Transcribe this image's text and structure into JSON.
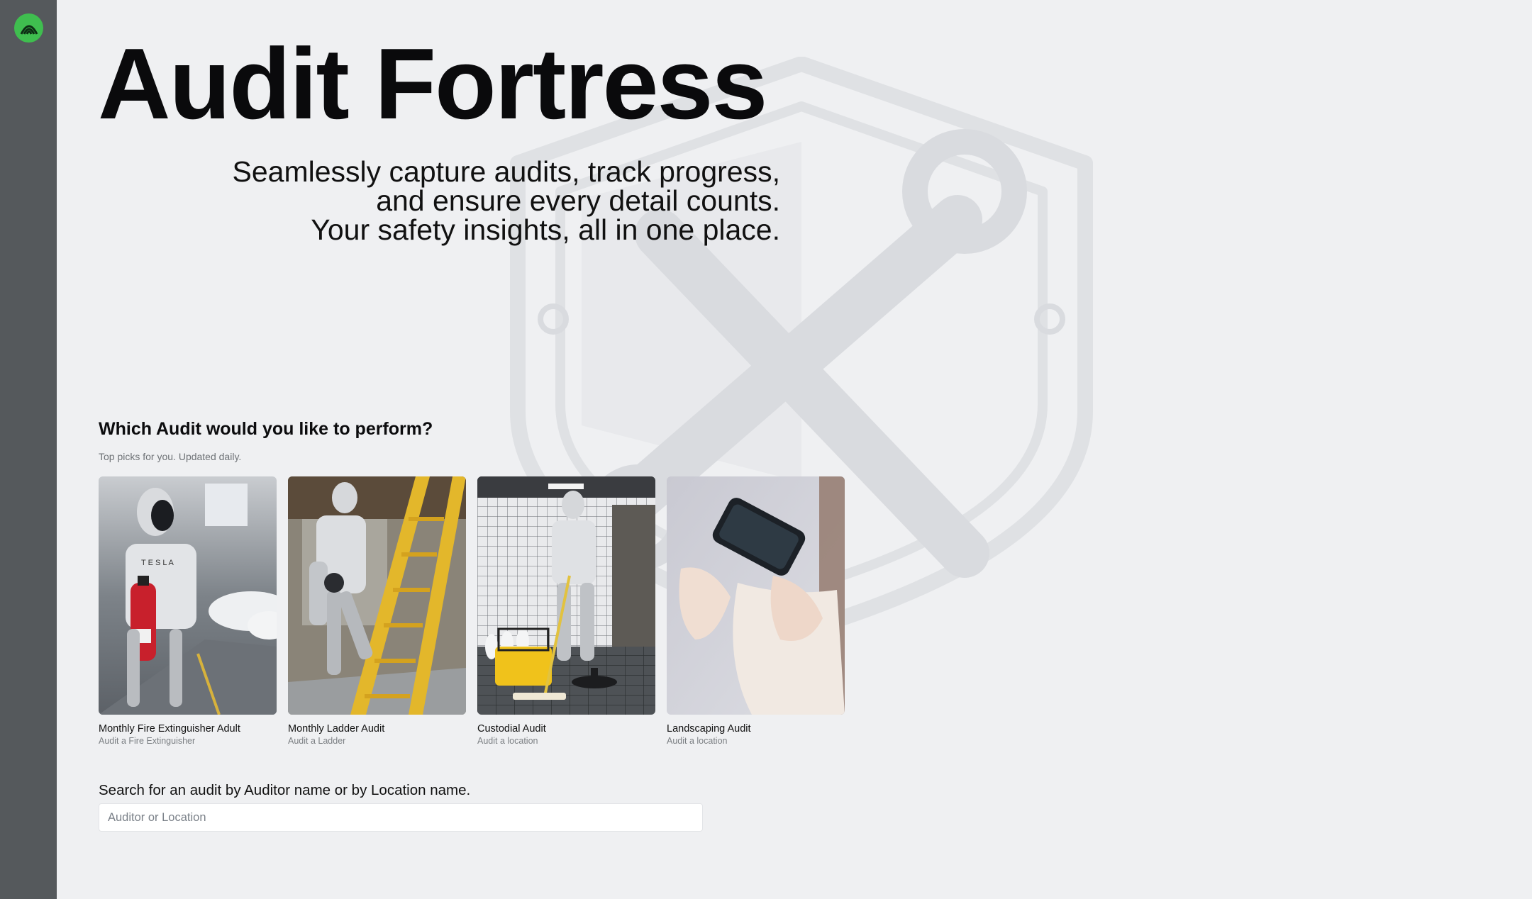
{
  "sidebar": {
    "logo_icon": "audit-fortress-logo-icon"
  },
  "hero": {
    "title": "Audit Fortress",
    "subtitle_lines": [
      "Seamlessly capture audits, track progress,",
      "and ensure every detail counts.",
      "Your safety insights, all in one place."
    ]
  },
  "audits": {
    "heading": "Which Audit would you like to perform?",
    "subheading": "Top picks for you. Updated daily.",
    "cards": [
      {
        "title": "Monthly Fire Extinguisher Adult",
        "subtitle": "Audit a Fire Extinguisher",
        "image": "robot-fire-extinguisher"
      },
      {
        "title": "Monthly Ladder Audit",
        "subtitle": "Audit a Ladder",
        "image": "robot-ladder"
      },
      {
        "title": "Custodial Audit",
        "subtitle": "Audit a location",
        "image": "robot-mopping-restroom"
      },
      {
        "title": "Landscaping Audit",
        "subtitle": "Audit a location",
        "image": "hands-holding-phone"
      }
    ]
  },
  "search": {
    "label": "Search for an audit by Auditor name or by Location name.",
    "placeholder": "Auditor or Location",
    "value": ""
  },
  "colors": {
    "sidebar": "#55595c",
    "background": "#eff0f2",
    "logo": "#3fbe4f",
    "ladder": "#e3b72b",
    "extinguisher": "#c8202c",
    "bucket": "#f0c21b"
  }
}
